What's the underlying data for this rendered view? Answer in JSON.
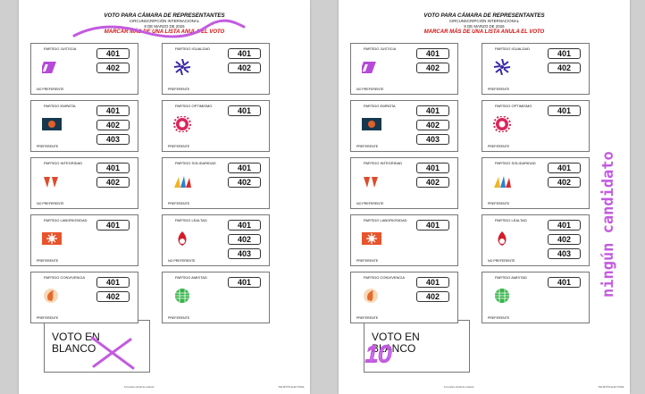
{
  "ballot": {
    "title": "VOTO PARA CÁMARA DE REPRESENTANTES",
    "subtitle": "CIRCUNSCRIPCIÓN INTERNACIONAL",
    "date": "8 DE MARZO DE 2026",
    "warning": "MARCAR MÁS DE UNA LISTA ANULA EL VOTO",
    "blank_vote": "VOTO EN BLANCO",
    "footer_left": "Formulario oficial de votación",
    "footer_right": "TARJETÓN ELECTORAL"
  },
  "parties": [
    {
      "name": "PARTIDO JUSTICIA",
      "pref": "NO PREFERENTE",
      "nums": [
        "401",
        "402"
      ],
      "icon": "justicia-logo-icon"
    },
    {
      "name": "PARTIDO IGUALDAD",
      "pref": "PREFERENTE",
      "nums": [
        "401",
        "402"
      ],
      "icon": "igualdad-logo-icon"
    },
    {
      "name": "PARTIDO EMPATÍA",
      "pref": "PREFERENTE",
      "nums": [
        "401",
        "402",
        "403"
      ],
      "icon": "empatia-logo-icon"
    },
    {
      "name": "PARTIDO OPTIMISMO",
      "pref": "PREFERENTE",
      "nums": [
        "401"
      ],
      "icon": "optimismo-logo-icon"
    },
    {
      "name": "PARTIDO INTEGRIDAD",
      "pref": "NO PREFERENTE",
      "nums": [
        "401",
        "402"
      ],
      "icon": "integridad-logo-icon"
    },
    {
      "name": "PARTIDO SOLIDARIDAD",
      "pref": "PREFERENTE",
      "nums": [
        "401",
        "402"
      ],
      "icon": "solidaridad-logo-icon"
    },
    {
      "name": "PARTIDO LABORIOSIDAD",
      "pref": "PREFERENTE",
      "nums": [
        "401"
      ],
      "icon": "laboriosidad-logo-icon"
    },
    {
      "name": "PARTIDO LEALTAD",
      "pref": "NO PREFERENTE",
      "nums": [
        "401",
        "402",
        "403"
      ],
      "icon": "lealtad-logo-icon"
    },
    {
      "name": "PARTIDO CONVIVENCIA",
      "pref": "PREFERENTE",
      "nums": [
        "401",
        "402"
      ],
      "icon": "convivencia-logo-icon"
    },
    {
      "name": "PARTIDO AMISTAD",
      "pref": "PREFERENTE",
      "nums": [
        "401"
      ],
      "icon": "amistad-logo-icon"
    }
  ],
  "annotations": {
    "side_note": "ningún candidato",
    "handwritten_mark": "10",
    "mark_color": "#c35be0"
  }
}
